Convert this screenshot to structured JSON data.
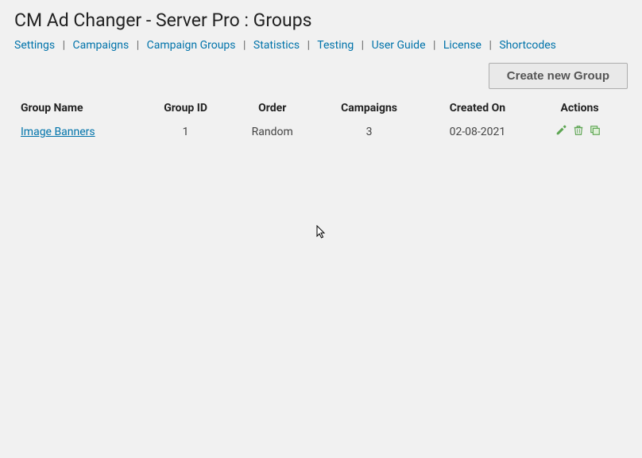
{
  "title": "CM Ad Changer - Server Pro : Groups",
  "nav": {
    "settings": "Settings",
    "campaigns": "Campaigns",
    "campaign_groups": "Campaign Groups",
    "statistics": "Statistics",
    "testing": "Testing",
    "user_guide": "User Guide",
    "license": "License",
    "shortcodes": "Shortcodes"
  },
  "buttons": {
    "create_group": "Create new Group"
  },
  "table": {
    "headers": {
      "group_name": "Group Name",
      "group_id": "Group ID",
      "order": "Order",
      "campaigns": "Campaigns",
      "created_on": "Created On",
      "actions": "Actions"
    },
    "rows": [
      {
        "group_name": "Image Banners",
        "group_id": "1",
        "order": "Random",
        "campaigns": "3",
        "created_on": "02-08-2021"
      }
    ]
  }
}
